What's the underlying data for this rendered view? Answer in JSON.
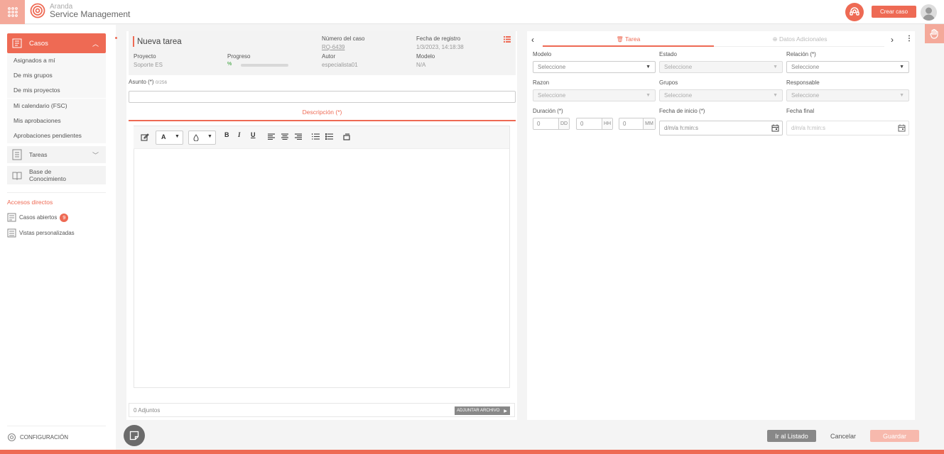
{
  "app": {
    "brand_line1": "Aranda",
    "brand_line2": "Service Management",
    "create_case_label": "Crear caso",
    "accent": "#ee6a54"
  },
  "sidebar": {
    "header_label": "Casos",
    "items": [
      {
        "label": "Asignados a mí"
      },
      {
        "label": "De mis grupos"
      },
      {
        "label": "De mis proyectos"
      },
      {
        "label": "Mi calendario (FSC)"
      },
      {
        "label": "Mis aprobaciones"
      },
      {
        "label": "Aprobaciones pendientes"
      }
    ],
    "tareas_label": "Tareas",
    "kb_label_1": "Base de",
    "kb_label_2": "Conocimiento",
    "accesos_title": "Accesos directos",
    "casos_abiertos_label": "Casos abiertos",
    "casos_abiertos_count": "9",
    "vistas_label": "Vistas personalizadas",
    "config_label": "CONFIGURACIÓN"
  },
  "header": {
    "title": "Nueva tarea",
    "numero_label": "Número del caso",
    "numero_value": "RQ-6439",
    "fecha_label": "Fecha de registro",
    "fecha_value": "1/3/2023, 14:18:38",
    "proyecto_label": "Proyecto",
    "proyecto_value": "Soporte ES",
    "progreso_label": "Progreso",
    "progreso_value": "%",
    "autor_label": "Autor",
    "autor_value": "especialista01",
    "modelo_label": "Modelo",
    "modelo_value": "N/A"
  },
  "form": {
    "asunto_label": "Asunto (*)",
    "asunto_counter": "0/256",
    "descripcion_tab": "Descripción (*)",
    "adjuntos_label": "0 Adjuntos",
    "adjuntar_label": "ADJUNTAR ARCHIVO"
  },
  "right": {
    "tab_tarea": "Tarea",
    "tab_datos": "Datos Adicionales",
    "modelo_label": "Modelo",
    "estado_label": "Estado",
    "relacion_label": "Relación (*)",
    "razon_label": "Razon",
    "grupos_label": "Grupos",
    "responsable_label": "Responsable",
    "duracion_label": "Duración (*)",
    "fecha_inicio_label": "Fecha de inicio (*)",
    "fecha_final_label": "Fecha final",
    "select_placeholder": "Seleccione",
    "dd_value": "0",
    "dd_unit": "DD",
    "hh_value": "0",
    "hh_unit": "HH",
    "mm_value": "0",
    "mm_unit": "MM",
    "date_placeholder": "d/m/a h:min:s"
  },
  "footer": {
    "listado_label": "Ir al Listado",
    "cancelar_label": "Cancelar",
    "guardar_label": "Guardar"
  }
}
